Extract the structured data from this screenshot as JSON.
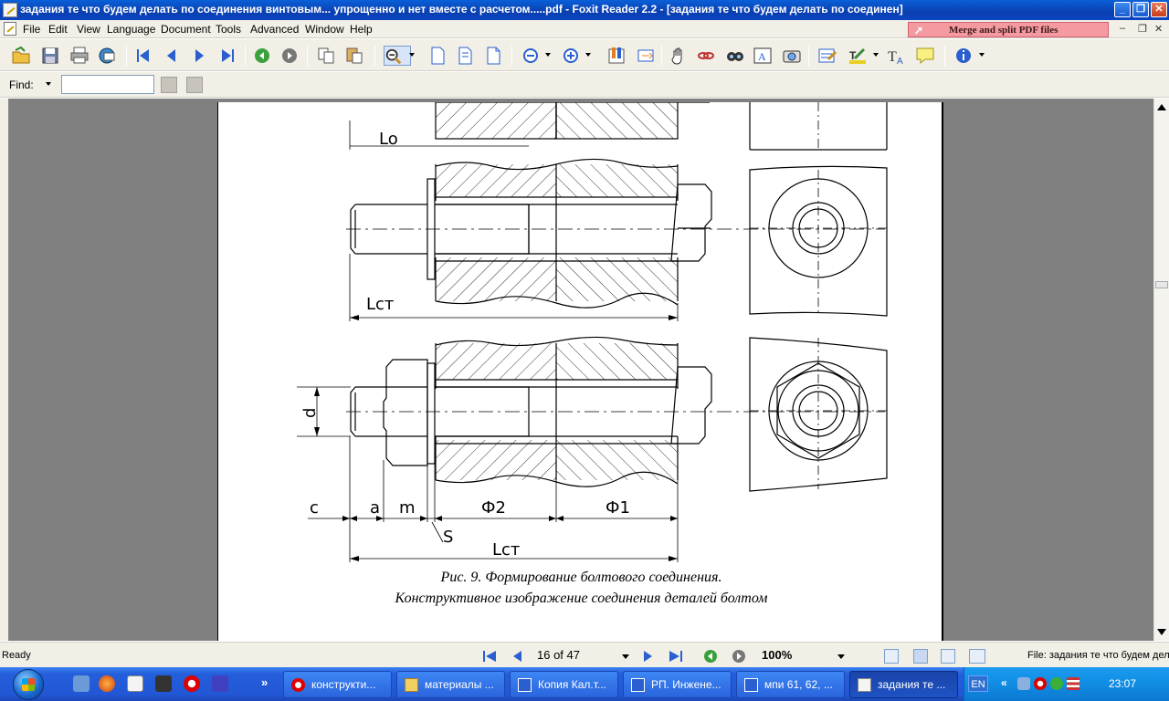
{
  "window": {
    "title": "задания те что будем делать по соединения винтовым... упрощенно и нет  вместе с расчетом.....pdf - Foxit Reader 2.2 - [задания те что будем делать по соединен]",
    "minimize": "_",
    "maximize": "❐",
    "close": "✕"
  },
  "menu": {
    "items": [
      "File",
      "Edit",
      "View",
      "Language",
      "Document",
      "Tools",
      "Advanced",
      "Window",
      "Help"
    ],
    "merge_banner": "Merge and split PDF files",
    "mdi_min": "‒",
    "mdi_restore": "❐",
    "mdi_close": "✕"
  },
  "toolbar": {
    "icons": [
      "open-icon",
      "save-icon",
      "print-icon",
      "email-icon",
      "first-page-icon",
      "prev-page-icon",
      "next-page-icon",
      "last-page-icon",
      "back-icon",
      "forward-icon",
      "copy-icon",
      "paste-icon",
      "zoom-icon",
      "single-page-icon",
      "continuous-icon",
      "facing-icon",
      "zoom-out-icon",
      "zoom-in-icon",
      "bookmark-icon",
      "fit-icon",
      "hand-icon",
      "link-icon",
      "find-icon",
      "text-select-icon",
      "snapshot-icon",
      "note-icon",
      "highlight-icon",
      "typewriter-icon",
      "comment-icon",
      "info-icon"
    ]
  },
  "findbar": {
    "label": "Find:",
    "value": ""
  },
  "document": {
    "dim_L0": "Lo",
    "dim_Lst": "Lст",
    "dim_Lst2": "Lст",
    "dim_d": "d",
    "dim_c": "c",
    "dim_a": "a",
    "dim_m": "m",
    "dim_s": "S",
    "dim_phi2": "Ф2",
    "dim_phi1": "Ф1",
    "caption_line1": "Рис. 9. Формирование болтового соединения.",
    "caption_line2": "Конструктивное изображение соединения деталей болтом"
  },
  "status": {
    "ready": "Ready",
    "page": "16 of 47",
    "zoom": "100%",
    "file": "File: задания те что будем делать"
  },
  "taskbar": {
    "more": "»",
    "tasks": [
      "конструкти...",
      "материалы ...",
      "Копия Кал.т...",
      "РП. Инжене...",
      "мпи 61, 62, ...",
      "задания те ..."
    ],
    "lang": "EN",
    "tray_more": "«",
    "clock": "23:07"
  },
  "colors": {
    "titlebar": "#0a4fc8",
    "taskbar": "#245edb",
    "merge_banner": "#f59aa0",
    "doc_bg": "#808080"
  }
}
